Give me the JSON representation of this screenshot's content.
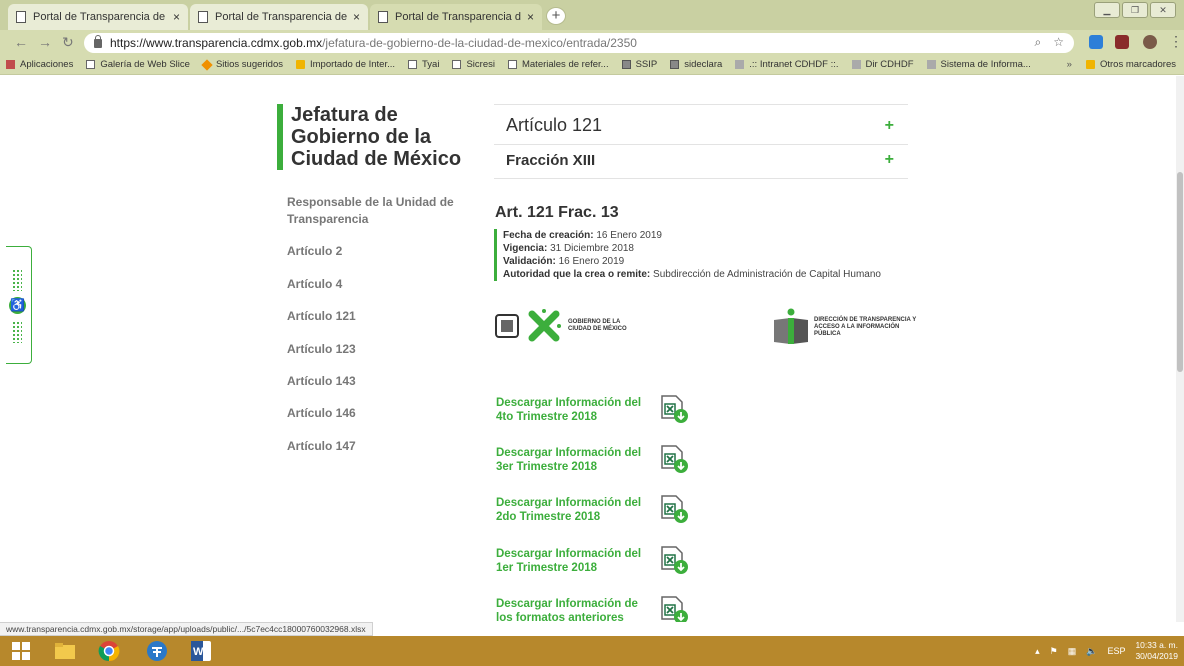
{
  "browser": {
    "tabs": [
      {
        "title": "Portal de Transparencia de la CD",
        "close": "×",
        "active": false
      },
      {
        "title": "Portal de Transparencia de la CD",
        "close": "×",
        "active": false
      },
      {
        "title": "Portal de Transparencia de la CD",
        "close": "×",
        "active": true
      }
    ],
    "new_tab": "+",
    "url_host": "https://www.transparencia.cdmx.gob.mx",
    "url_path": "/jefatura-de-gobierno-de-la-ciudad-de-mexico/entrada/2350",
    "bookmarks": [
      {
        "label": "Aplicaciones",
        "icon": "grid"
      },
      {
        "label": "Galería de Web Slice",
        "icon": "page"
      },
      {
        "label": "Sitios sugeridos",
        "icon": "diamond"
      },
      {
        "label": "Importado de Inter...",
        "icon": "folder"
      },
      {
        "label": "Tyai",
        "icon": "page"
      },
      {
        "label": "Sicresi",
        "icon": "page"
      },
      {
        "label": "Materiales de refer...",
        "icon": "page"
      },
      {
        "label": "SSIP",
        "icon": "img"
      },
      {
        "label": "sideclara",
        "icon": "img"
      },
      {
        "label": ".:: Intranet CDHDF ::.",
        "icon": "grey"
      },
      {
        "label": "Dir CDHDF",
        "icon": "grey"
      },
      {
        "label": "Sistema de Informa...",
        "icon": "grey"
      }
    ],
    "bookmarks_more": "»",
    "other_bookmarks": "Otros marcadores",
    "status_url": "www.transparencia.cdmx.gob.mx/storage/app/uploads/public/.../5c7ec4cc18000760032968.xlsx"
  },
  "sidebar": {
    "title": "Jefatura de Gobierno de la Ciudad de México",
    "items": [
      "Responsable de la Unidad de Transparencia",
      "Artículo 2",
      "Artículo 4",
      "Artículo 121",
      "Artículo 123",
      "Artículo 143",
      "Artículo 146",
      "Artículo 147"
    ]
  },
  "main": {
    "accordion1": "Artículo 121",
    "accordion2": "Fracción XIII",
    "plus": "+",
    "heading": "Art. 121 Frac. 13",
    "meta": {
      "creacion_label": "Fecha de creación:",
      "creacion": "16 Enero 2019",
      "vigencia_label": "Vigencia:",
      "vigencia": "31 Diciembre 2018",
      "validacion_label": "Validación:",
      "validacion": "16 Enero 2019",
      "autoridad_label": "Autoridad que la crea o remite:",
      "autoridad": "Subdirección de Administración de Capital Humano"
    },
    "logo_gobierno": "GOBIERNO DE LA CIUDAD DE MÉXICO",
    "logo_transparencia": "DIRECCIÓN DE TRANSPARENCIA Y ACCESO A LA INFORMACIÓN PÚBLICA",
    "downloads": [
      "Descargar Información del 4to Trimestre 2018",
      "Descargar Información del 3er Trimestre 2018",
      "Descargar Información del 2do Trimestre 2018",
      "Descargar Información del 1er Trimestre 2018",
      "Descargar Información de los formatos anteriores"
    ]
  },
  "taskbar": {
    "language": "ESP",
    "time": "10:33 a. m.",
    "date": "30/04/2019"
  },
  "colors": {
    "accent": "#3cae3c",
    "chrome": "#d6dcb1",
    "taskbar": "#b7882c"
  }
}
